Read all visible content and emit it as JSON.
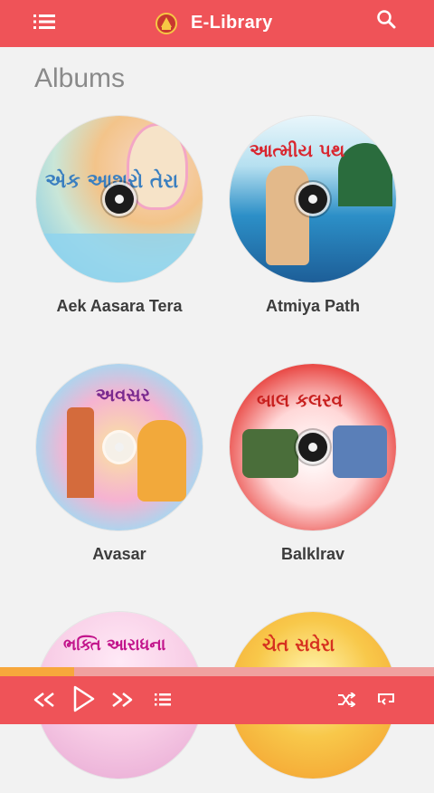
{
  "app": {
    "title": "E-Library",
    "section_heading": "Albums"
  },
  "albums": [
    {
      "title": "Aek Aasara Tera",
      "disc_text": "એક આશરો તેરા"
    },
    {
      "title": "Atmiya Path",
      "disc_text": "આત્મીય પથ"
    },
    {
      "title": "Avasar",
      "disc_text": "અવસર"
    },
    {
      "title": "Balklrav",
      "disc_text": "બાલ કલરવ"
    },
    {
      "title": "",
      "disc_text": "ભક્તિ આરાધના"
    },
    {
      "title": "",
      "disc_text": "ચેત સવેરા"
    }
  ],
  "player": {
    "progress_fraction": 0.17
  },
  "colors": {
    "primary": "#ef5358",
    "accent": "#f7a73c",
    "background": "#f2f2f2"
  },
  "icons": {
    "menu": "list-icon",
    "search": "search-icon",
    "previous": "rewind-icon",
    "play": "play-icon",
    "next": "fast-forward-icon",
    "playlist": "playlist-icon",
    "shuffle": "shuffle-icon",
    "repeat": "repeat-icon"
  }
}
